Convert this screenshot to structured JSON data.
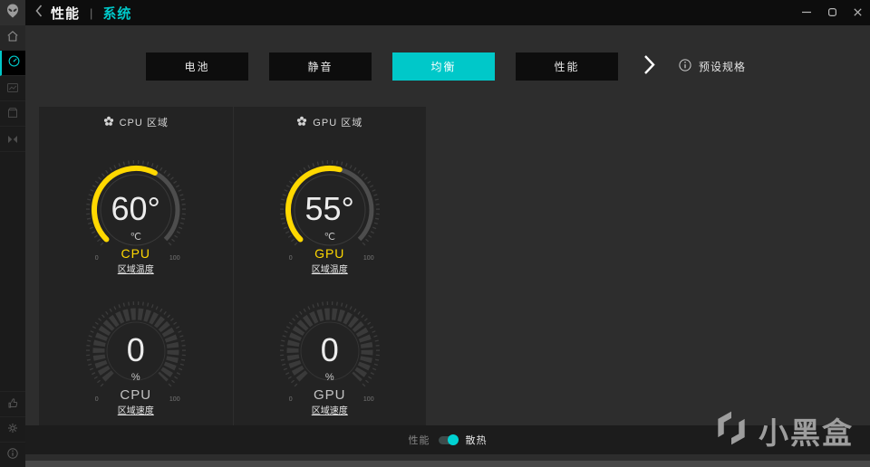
{
  "titlebar": {
    "app_icon": "alien-head",
    "back_icon": "back-chevron",
    "section_title": "性能",
    "separator": "|",
    "page_title": "系统",
    "window_controls": {
      "minimize": "minimize",
      "maximize": "maximize",
      "close": "close"
    }
  },
  "sidebar": {
    "items": [
      {
        "icon": "home"
      },
      {
        "icon": "performance-gauge",
        "active": true
      },
      {
        "icon": "library-graph"
      },
      {
        "icon": "content-box"
      },
      {
        "icon": "fx-fusion"
      }
    ],
    "bottom_items": [
      {
        "icon": "thumbs-up"
      },
      {
        "icon": "settings-gear"
      },
      {
        "icon": "info"
      }
    ]
  },
  "tabs": {
    "items": [
      {
        "label": "电池",
        "active": false
      },
      {
        "label": "静音",
        "active": false
      },
      {
        "label": "均衡",
        "active": true
      },
      {
        "label": "性能",
        "active": false
      }
    ],
    "more_icon": "chevron-right",
    "preset": {
      "icon": "info-circle",
      "label": "预设规格"
    }
  },
  "zones": [
    {
      "header_icon": "fan",
      "header": "CPU 区域",
      "temp_gauge": {
        "value": "60°",
        "unit": "℃",
        "label": "CPU",
        "sublabel": "区域温度",
        "percent": 60,
        "min": "0",
        "max": "100"
      },
      "speed_gauge": {
        "value": "0",
        "unit": "%",
        "label": "CPU",
        "sublabel": "区域速度",
        "percent": 0,
        "min": "0",
        "max": "100"
      }
    },
    {
      "header_icon": "fan",
      "header": "GPU 区域",
      "temp_gauge": {
        "value": "55°",
        "unit": "℃",
        "label": "GPU",
        "sublabel": "区域温度",
        "percent": 55,
        "min": "0",
        "max": "100"
      },
      "speed_gauge": {
        "value": "0",
        "unit": "%",
        "label": "GPU",
        "sublabel": "区域速度",
        "percent": 0,
        "min": "0",
        "max": "100"
      }
    }
  ],
  "bottom_bar": {
    "left_label": "性能",
    "right_label": "散热",
    "toggle_position": "right"
  },
  "watermark": {
    "logo": "heybox-logo",
    "text": "小黑盒"
  },
  "colors": {
    "accent": "#00c8c9",
    "gauge_yellow": "#ffd800",
    "gauge_track": "#4d4d4d"
  }
}
